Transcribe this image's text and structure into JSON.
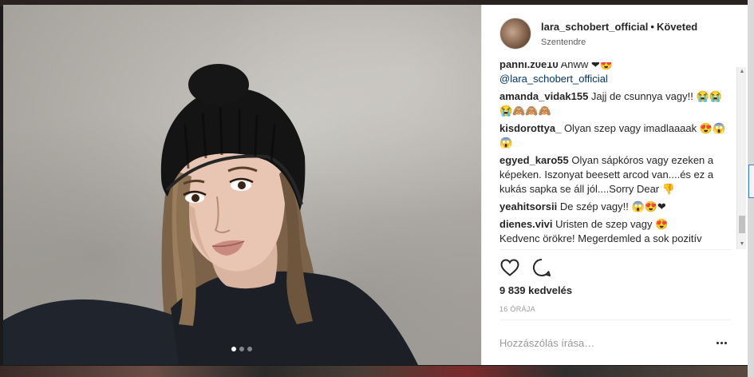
{
  "post": {
    "username": "lara_schobert_official",
    "separator": "•",
    "follow_state": "Követed",
    "location": "Szentendre",
    "likes": "9 839 kedvelés",
    "timestamp": "16 ÓRÁJA",
    "comment_placeholder": "Hozzászólás írása…",
    "carousel": {
      "total": 3,
      "active_index": 0
    }
  },
  "comments": [
    {
      "user": "panni.z0e10",
      "text": "Anww",
      "emoji": "❤😍",
      "mention": "@lara_schobert_official"
    },
    {
      "user": "amanda_vidak155",
      "text": "Jajj de csunnya vagy!!",
      "emoji": "😭😭😭🙈🙈🙈"
    },
    {
      "user": "kisdorottya_",
      "text": "Olyan szep vagy imadlaaaak",
      "emoji": "😍😱😱"
    },
    {
      "user": "egyed_karo55",
      "text": "Olyan sápkóros vagy ezeken a képeken. Iszonyat beesett arcod van....és ez a kukás sapka se áll jól....Sorry Dear",
      "emoji": "👎"
    },
    {
      "user": "yeahitsorsii",
      "text": "De szép vagy!!",
      "emoji": "😱😍❤"
    },
    {
      "user": "dienes.vivi",
      "text": "Uristen de szep vagy",
      "emoji": "😍",
      "extra": "Kedvenc örökre! Megerdemled a sok pozitív"
    }
  ],
  "icons": {
    "like": "heart-icon",
    "comment": "comment-icon",
    "more": "more-options-icon"
  },
  "colors": {
    "text": "#262626",
    "muted": "#999999",
    "mention": "#003569",
    "border": "#efefef"
  }
}
